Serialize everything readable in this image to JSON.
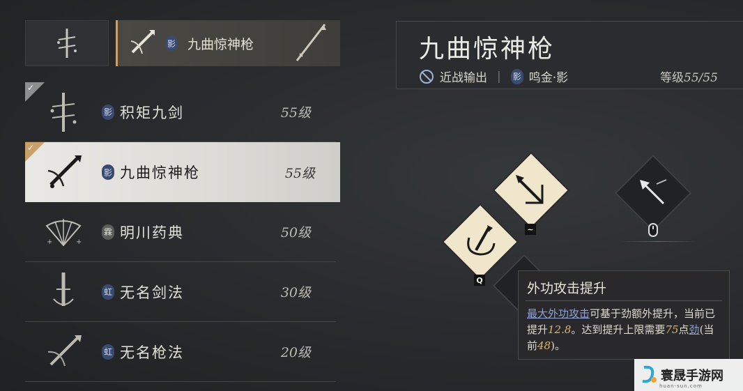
{
  "top_tabs": {
    "selected": {
      "badge": "影",
      "name": "九曲惊神枪"
    }
  },
  "weapons": [
    {
      "badge": "影",
      "badge_style": "blue",
      "name": "积矩九剑",
      "level": "55级",
      "checked": true,
      "active": false
    },
    {
      "badge": "影",
      "badge_style": "blue",
      "name": "九曲惊神枪",
      "level": "55级",
      "checked": true,
      "active": true
    },
    {
      "badge": "霖",
      "badge_style": "gray",
      "name": "明川药典",
      "level": "50级",
      "checked": false,
      "active": false
    },
    {
      "badge": "虹",
      "badge_style": "blue",
      "name": "无名剑法",
      "level": "30级",
      "checked": false,
      "active": false
    },
    {
      "badge": "虹",
      "badge_style": "blue",
      "name": "无名枪法",
      "level": "20级",
      "checked": false,
      "active": false
    }
  ],
  "header": {
    "title": "九曲惊神枪",
    "role": "近战输出",
    "path_badge": "影",
    "path": "鸣金·影",
    "level_label": "等级",
    "level_value": "55/55"
  },
  "skills": {
    "key_q": "Q",
    "key_tilde": "~"
  },
  "tooltip": {
    "title": "外功攻击提升",
    "link1": "最大外功攻击",
    "text1": "可基于劲额外提升，当前已提升",
    "num1": "12.8",
    "text2": "。达到提升上限需要",
    "num2": "75",
    "text3": "点",
    "link2": "劲",
    "text4": "(当前",
    "num3": "48",
    "text5": ")。"
  },
  "watermark": {
    "text": "寰晟手游网",
    "sub": "huan-sun.com"
  },
  "colors": {
    "accent_gold": "#c8a26a",
    "badge_blue": "#3a4a6e",
    "tooltip_number": "#e1b36a",
    "tooltip_link": "#8fa2d6"
  }
}
